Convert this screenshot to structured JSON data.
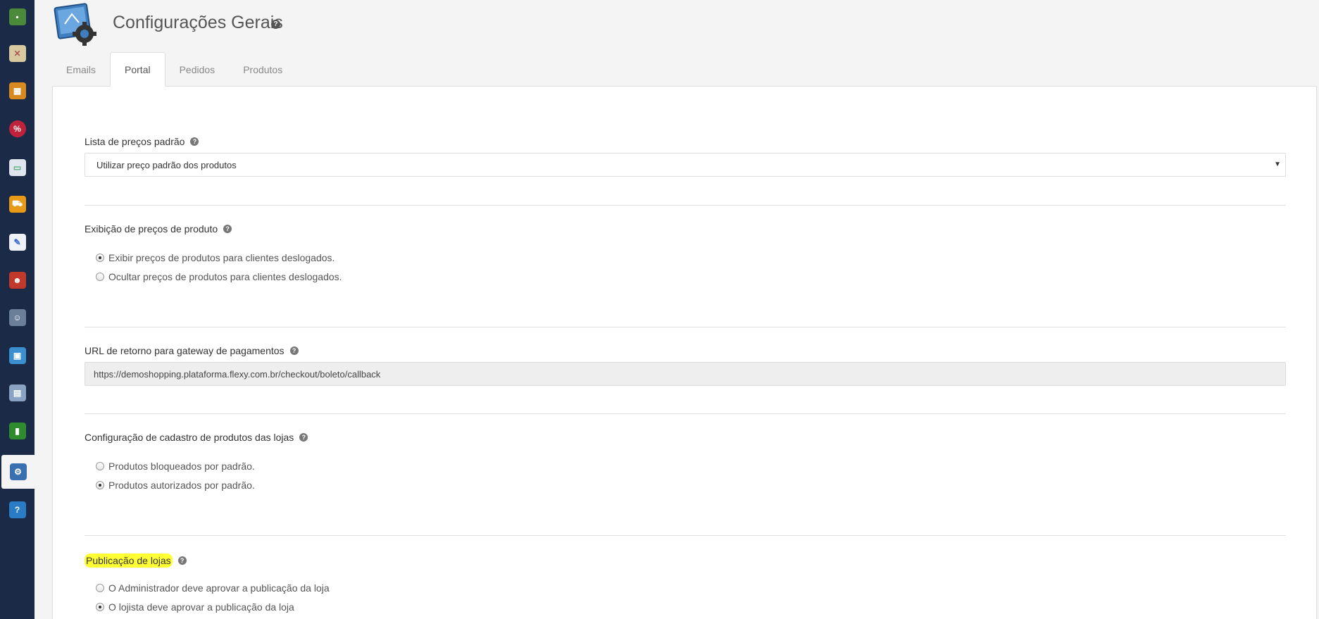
{
  "header": {
    "title": "Configurações Gerais"
  },
  "tabs": [
    {
      "label": "Emails"
    },
    {
      "label": "Portal"
    },
    {
      "label": "Pedidos"
    },
    {
      "label": "Produtos"
    }
  ],
  "sidebar": {
    "items": [
      {
        "icon": "box-icon"
      },
      {
        "icon": "map-icon"
      },
      {
        "icon": "package-icon"
      },
      {
        "icon": "discount-icon"
      },
      {
        "icon": "card-icon"
      },
      {
        "icon": "truck-icon"
      },
      {
        "icon": "note-icon"
      },
      {
        "icon": "users-icon"
      },
      {
        "icon": "user-icon"
      },
      {
        "icon": "image-icon"
      },
      {
        "icon": "document-icon"
      },
      {
        "icon": "chart-icon"
      },
      {
        "icon": "settings-icon"
      },
      {
        "icon": "help-book-icon"
      }
    ]
  },
  "price_list": {
    "label": "Lista de preços padrão",
    "selected": "Utilizar preço padrão dos produtos"
  },
  "price_display": {
    "label": "Exibição de preços de produto",
    "options": [
      {
        "label": "Exibir preços de produtos para clientes deslogados.",
        "checked": true
      },
      {
        "label": "Ocultar preços de produtos para clientes deslogados.",
        "checked": false
      }
    ]
  },
  "gateway_url": {
    "label": "URL de retorno para gateway de pagamentos",
    "value": "https://demoshopping.plataforma.flexy.com.br/checkout/boleto/callback"
  },
  "product_registration": {
    "label": "Configuração de cadastro de produtos das lojas",
    "options": [
      {
        "label": "Produtos bloqueados por padrão.",
        "checked": false
      },
      {
        "label": "Produtos autorizados por padrão.",
        "checked": true
      }
    ]
  },
  "store_publication": {
    "label": "Publicação de lojas",
    "options": [
      {
        "label": "O Administrador deve aprovar a publicação da loja",
        "checked": false
      },
      {
        "label": "O lojista deve aprovar a publicação da loja",
        "checked": true
      }
    ]
  }
}
